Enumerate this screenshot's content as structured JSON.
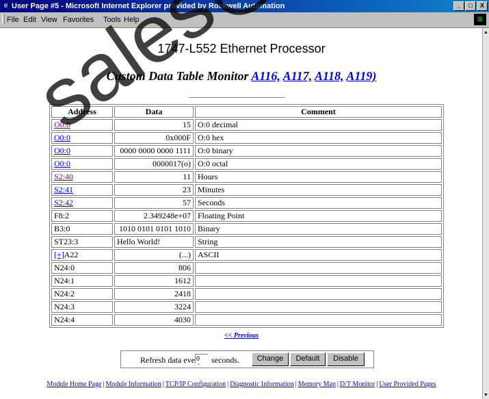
{
  "window": {
    "title": "User Page #5 - Microsoft Internet Explorer provided by Rockwell Automation",
    "buttons": [
      "_",
      "□",
      "X"
    ]
  },
  "menubar": {
    "items": [
      "File",
      "Edit",
      "View",
      "Favorites",
      "Tools",
      "Help"
    ]
  },
  "page": {
    "title": "1747-L552 Ethernet Processor",
    "subtitle_prefix": "Custom Data Table Monitor ",
    "subtitle_paren_open": "(",
    "subtitle_links": [
      "A116,",
      "A117,",
      "A118,",
      "A119)"
    ],
    "subtitle_sep": " "
  },
  "table": {
    "headers": [
      "Address",
      "Data",
      "Comment"
    ],
    "rows": [
      {
        "address": "O0:0",
        "link": true,
        "visited": true,
        "data": "15",
        "comment": "O:0 decimal",
        "align": "right"
      },
      {
        "address": "O0:0",
        "link": true,
        "visited": false,
        "data": "0x000F",
        "comment": "O:0 hex",
        "align": "right"
      },
      {
        "address": "O0:0",
        "link": true,
        "visited": false,
        "data": "0000 0000 0000 1111",
        "comment": "O:0 binary",
        "align": "right"
      },
      {
        "address": "O0:0",
        "link": true,
        "visited": false,
        "data": "0000017(o)",
        "comment": "O:0 octal",
        "align": "right"
      },
      {
        "address": "S2:40",
        "link": true,
        "visited": true,
        "data": "11",
        "comment": "Hours",
        "align": "right"
      },
      {
        "address": "S2:41",
        "link": true,
        "visited": false,
        "data": "23",
        "comment": "Minutes",
        "align": "right"
      },
      {
        "address": "S2:42",
        "link": true,
        "visited": false,
        "data": "57",
        "comment": "Seconds",
        "align": "right"
      },
      {
        "address": "F8:2",
        "link": false,
        "visited": false,
        "data": "2.349248e+07",
        "comment": "Floating Point",
        "align": "right"
      },
      {
        "address": "B3:0",
        "link": false,
        "visited": false,
        "data": "1010 0101 0101 1010",
        "comment": "Binary",
        "align": "right"
      },
      {
        "address": "ST23:3",
        "link": false,
        "visited": false,
        "data": "Hello World!",
        "comment": "String",
        "align": "left"
      },
      {
        "address": "A22",
        "link": false,
        "expander": "[+]",
        "visited": false,
        "data": "(...)",
        "comment": "ASCII",
        "align": "right"
      },
      {
        "address": "N24:0",
        "link": false,
        "visited": false,
        "data": "806",
        "comment": "",
        "align": "right"
      },
      {
        "address": "N24:1",
        "link": false,
        "visited": false,
        "data": "1612",
        "comment": "",
        "align": "right"
      },
      {
        "address": "N24:2",
        "link": false,
        "visited": false,
        "data": "2418",
        "comment": "",
        "align": "right"
      },
      {
        "address": "N24:3",
        "link": false,
        "visited": false,
        "data": "3224",
        "comment": "",
        "align": "right"
      },
      {
        "address": "N24:4",
        "link": false,
        "visited": false,
        "data": "4030",
        "comment": "",
        "align": "right"
      }
    ]
  },
  "nav": {
    "previous": "<< Previous"
  },
  "refresh": {
    "label_before": "Refresh data every",
    "value": "0",
    "label_after": "seconds.",
    "change": "Change",
    "default": "Default",
    "disable": "Disable"
  },
  "footer": {
    "links": [
      "Module Home Page",
      "Module Information",
      "TCP/IP Configuration",
      "Diagnostic Information",
      "Memory Map",
      "D/T Monitor",
      "User Provided Pages"
    ],
    "separator": "|"
  },
  "watermark": "sales@"
}
